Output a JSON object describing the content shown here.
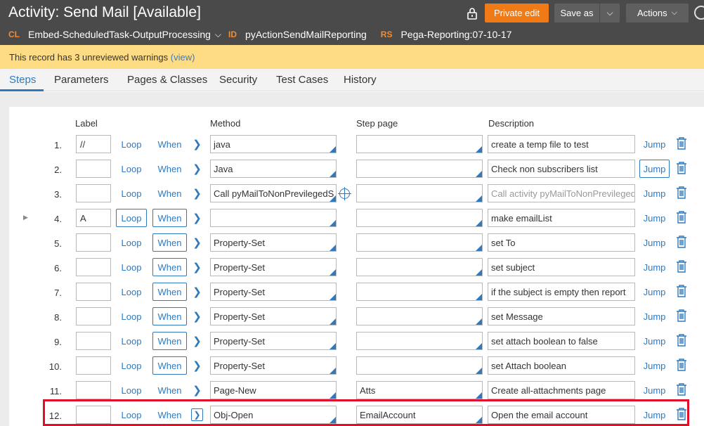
{
  "header": {
    "title": "Activity: Send Mail [Available]",
    "meta": [
      {
        "key": "CL",
        "value": "Embed-ScheduledTask-OutputProcessing",
        "dropdown": true
      },
      {
        "key": "ID",
        "value": "pyActionSendMailReporting",
        "dropdown": false
      },
      {
        "key": "RS",
        "value": "Pega-Reporting:07-10-17",
        "dropdown": false
      }
    ],
    "private_edit_label": "Private edit",
    "save_as_label": "Save as",
    "actions_label": "Actions",
    "colors": {
      "header_bg": "#4a4a4a",
      "accent_orange": "#f07b16",
      "warning_bg": "#fddc84",
      "link_blue": "#2f7abf",
      "highlight_red": "#e0102a"
    }
  },
  "warning": {
    "text": "This record has 3 unreviewed warnings",
    "link": "(view)"
  },
  "tabs": [
    {
      "label": "Steps",
      "active": true
    },
    {
      "label": "Parameters",
      "active": false
    },
    {
      "label": "Pages & Classes",
      "active": false
    },
    {
      "label": "Security",
      "active": false
    },
    {
      "label": "Test Cases",
      "active": false
    },
    {
      "label": "History",
      "active": false
    }
  ],
  "columns": {
    "label": "Label",
    "method": "Method",
    "step_page": "Step page",
    "description": "Description"
  },
  "steps": [
    {
      "num": "1.",
      "label": "//",
      "loop": "Loop",
      "when": "When",
      "method": "java",
      "step_page": "",
      "description": "create a temp file to test",
      "jump": "Jump"
    },
    {
      "num": "2.",
      "label": "",
      "loop": "Loop",
      "when": "When",
      "method": "Java",
      "step_page": "",
      "description": "Check non subscribers list",
      "jump": "Jump"
    },
    {
      "num": "3.",
      "label": "",
      "loop": "Loop",
      "when": "When",
      "method": "Call pyMailToNonPrevilegedS",
      "step_page": "",
      "description": "Call activity pyMailToNonPrevilegedS",
      "jump": "Jump"
    },
    {
      "num": "4.",
      "label": "A",
      "loop": "Loop",
      "when": "When",
      "method": "",
      "step_page": "",
      "description": "make emailList",
      "jump": "Jump"
    },
    {
      "num": "5.",
      "label": "",
      "loop": "Loop",
      "when": "When",
      "method": "Property-Set",
      "step_page": "",
      "description": "set To",
      "jump": "Jump"
    },
    {
      "num": "6.",
      "label": "",
      "loop": "Loop",
      "when": "When",
      "method": "Property-Set",
      "step_page": "",
      "description": "set subject",
      "jump": "Jump"
    },
    {
      "num": "7.",
      "label": "",
      "loop": "Loop",
      "when": "When",
      "method": "Property-Set",
      "step_page": "",
      "description": "if the subject is empty then report",
      "jump": "Jump"
    },
    {
      "num": "8.",
      "label": "",
      "loop": "Loop",
      "when": "When",
      "method": "Property-Set",
      "step_page": "",
      "description": "set Message",
      "jump": "Jump"
    },
    {
      "num": "9.",
      "label": "",
      "loop": "Loop",
      "when": "When",
      "method": "Property-Set",
      "step_page": "",
      "description": "set attach boolean to false",
      "jump": "Jump"
    },
    {
      "num": "10.",
      "label": "",
      "loop": "Loop",
      "when": "When",
      "method": "Property-Set",
      "step_page": "",
      "description": "set Attach boolean",
      "jump": "Jump"
    },
    {
      "num": "11.",
      "label": "",
      "loop": "Loop",
      "when": "When",
      "method": "Page-New",
      "step_page": "Atts",
      "description": "Create all-attachments page",
      "jump": "Jump"
    },
    {
      "num": "12.",
      "label": "",
      "loop": "Loop",
      "when": "When",
      "method": "Obj-Open",
      "step_page": "EmailAccount",
      "description": "Open the email account",
      "jump": "Jump"
    }
  ]
}
